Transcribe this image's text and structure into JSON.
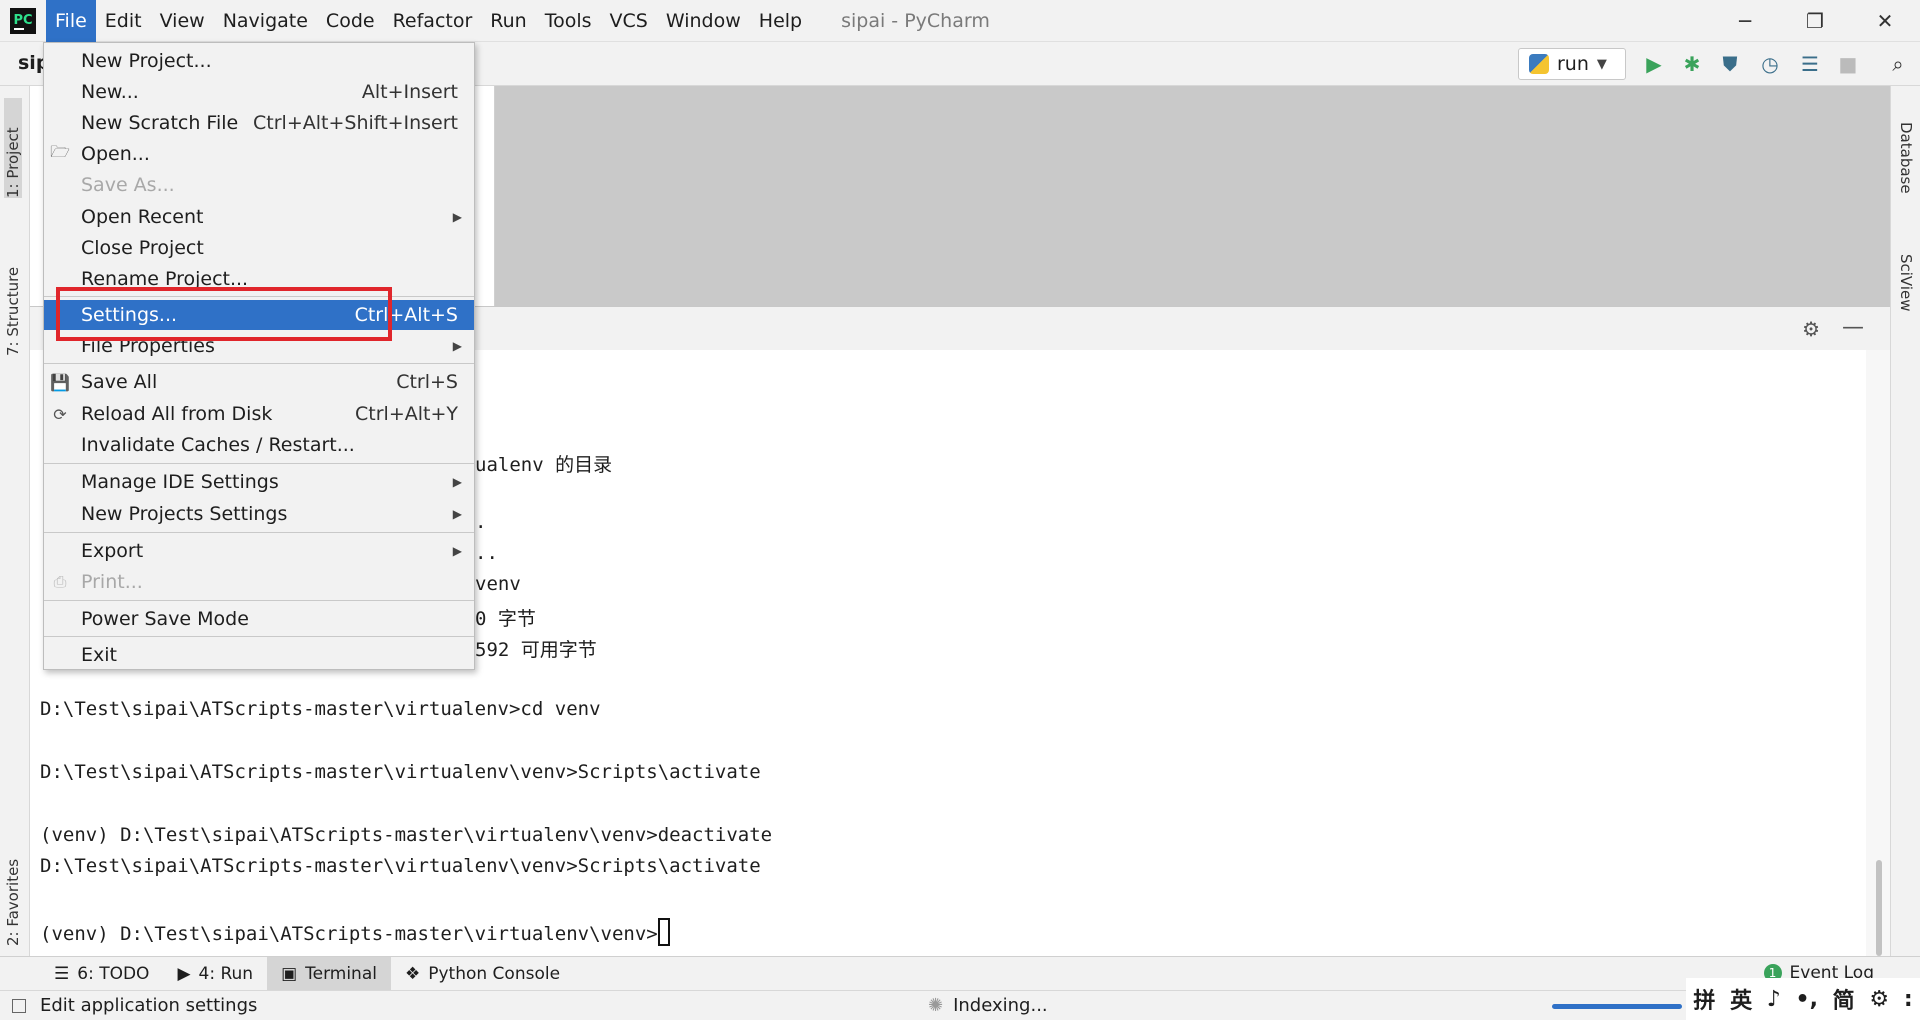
{
  "app": {
    "logo_text": "PC",
    "window_title": "sipai - PyCharm",
    "project_name": "sip"
  },
  "menubar": [
    "File",
    "Edit",
    "View",
    "Navigate",
    "Code",
    "Refactor",
    "Run",
    "Tools",
    "VCS",
    "Window",
    "Help"
  ],
  "window_controls": {
    "minimize": "─",
    "restore": "❐",
    "close": "✕"
  },
  "toolbar": {
    "run_config": "run"
  },
  "left_tabs": [
    "1: Project",
    "7: Structure",
    "2: Favorites"
  ],
  "right_tabs": [
    "Database",
    "SciView"
  ],
  "file_menu": {
    "new_project": "New Project...",
    "new": "New...",
    "new_sc": "Alt+Insert",
    "new_scratch": "New Scratch File",
    "new_scratch_sc": "Ctrl+Alt+Shift+Insert",
    "open": "Open...",
    "save_as": "Save As...",
    "open_recent": "Open Recent",
    "close_project": "Close Project",
    "rename_project": "Rename Project...",
    "settings": "Settings...",
    "settings_sc": "Ctrl+Alt+S",
    "file_properties": "File Properties",
    "save_all": "Save All",
    "save_all_sc": "Ctrl+S",
    "reload": "Reload All from Disk",
    "reload_sc": "Ctrl+Alt+Y",
    "invalidate": "Invalidate Caches / Restart...",
    "manage_ide": "Manage IDE Settings",
    "new_projects_settings": "New Projects Settings",
    "export": "Export",
    "print": "Print...",
    "power_save": "Power Save Mode",
    "exit": "Exit"
  },
  "terminal": {
    "lines": [
      "ualenv 的目录",
      ".",
      "..",
      "venv",
      "0 字节",
      "592 可用字节",
      "D:\\Test\\sipai\\ATScripts-master\\virtualenv>cd venv",
      "D:\\Test\\sipai\\ATScripts-master\\virtualenv\\venv>Scripts\\activate",
      "(venv) D:\\Test\\sipai\\ATScripts-master\\virtualenv\\venv>deactivate",
      "D:\\Test\\sipai\\ATScripts-master\\virtualenv\\venv>Scripts\\activate",
      "(venv) D:\\Test\\sipai\\ATScripts-master\\virtualenv\\venv>"
    ]
  },
  "bottom_tabs": {
    "todo": "6: TODO",
    "run": "4: Run",
    "terminal": "Terminal",
    "python_console": "Python Console",
    "event_log": "Event Log",
    "event_count": "1"
  },
  "status": {
    "left": "Edit application settings",
    "indexing": "Indexing..."
  },
  "ime": [
    "拼",
    "英",
    "♪",
    "•,",
    "简",
    "⚙",
    ":"
  ],
  "colors": {
    "accent": "#2f71c7",
    "callout": "#e0262b",
    "run_green": "#3aa35b"
  }
}
